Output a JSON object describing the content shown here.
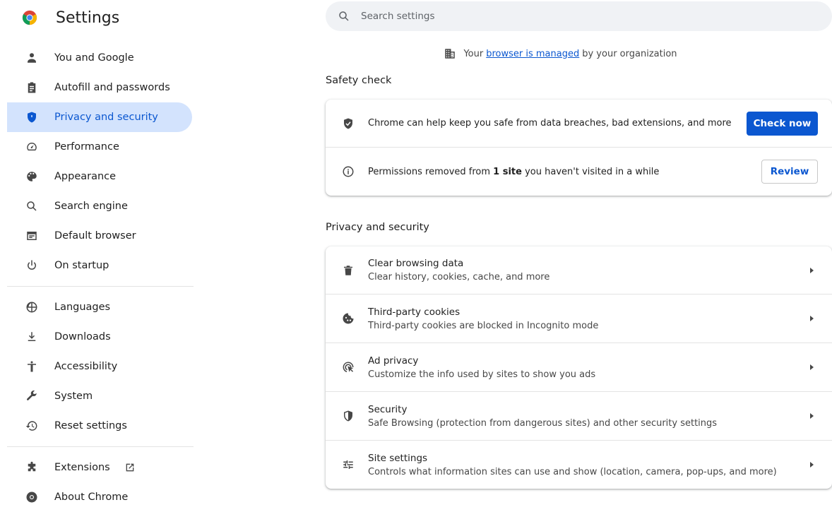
{
  "app": {
    "title": "Settings"
  },
  "sidebar": {
    "items": [
      {
        "label": "You and Google",
        "icon": "person-icon"
      },
      {
        "label": "Autofill and passwords",
        "icon": "clipboard-icon"
      },
      {
        "label": "Privacy and security",
        "icon": "shield-icon",
        "active": true
      },
      {
        "label": "Performance",
        "icon": "speedometer-icon"
      },
      {
        "label": "Appearance",
        "icon": "palette-icon"
      },
      {
        "label": "Search engine",
        "icon": "search-icon"
      },
      {
        "label": "Default browser",
        "icon": "browser-window-icon"
      },
      {
        "label": "On startup",
        "icon": "power-icon"
      },
      {
        "label": "Languages",
        "icon": "globe-icon"
      },
      {
        "label": "Downloads",
        "icon": "download-icon"
      },
      {
        "label": "Accessibility",
        "icon": "accessibility-icon"
      },
      {
        "label": "System",
        "icon": "wrench-icon"
      },
      {
        "label": "Reset settings",
        "icon": "reset-history-icon"
      },
      {
        "label": "Extensions",
        "icon": "puzzle-icon"
      },
      {
        "label": "About Chrome",
        "icon": "chrome-icon"
      }
    ]
  },
  "search": {
    "placeholder": "Search settings"
  },
  "managed": {
    "prefix": "Your",
    "link": "browser is managed",
    "suffix": "by your organization"
  },
  "safety_check": {
    "title": "Safety check",
    "rows": [
      {
        "text": "Chrome can help keep you safe from data breaches, bad extensions, and more",
        "button": "Check now"
      },
      {
        "text_before": "Permissions removed from",
        "text_bold": "1 site",
        "text_after": "you haven't visited in a while",
        "button": "Review"
      }
    ]
  },
  "privacy": {
    "title": "Privacy and security",
    "rows": [
      {
        "title": "Clear browsing data",
        "subtitle": "Clear history, cookies, cache, and more"
      },
      {
        "title": "Third-party cookies",
        "subtitle": "Third-party cookies are blocked in Incognito mode"
      },
      {
        "title": "Ad privacy",
        "subtitle": "Customize the info used by sites to show you ads"
      },
      {
        "title": "Security",
        "subtitle": "Safe Browsing (protection from dangerous sites) and other security settings"
      },
      {
        "title": "Site settings",
        "subtitle": "Controls what information sites can use and show (location, camera, pop-ups, and more)"
      }
    ]
  },
  "colors": {
    "accent": "#0b57d0",
    "active_bg": "#d3e3fd",
    "search_bg": "#f0f2f5"
  }
}
